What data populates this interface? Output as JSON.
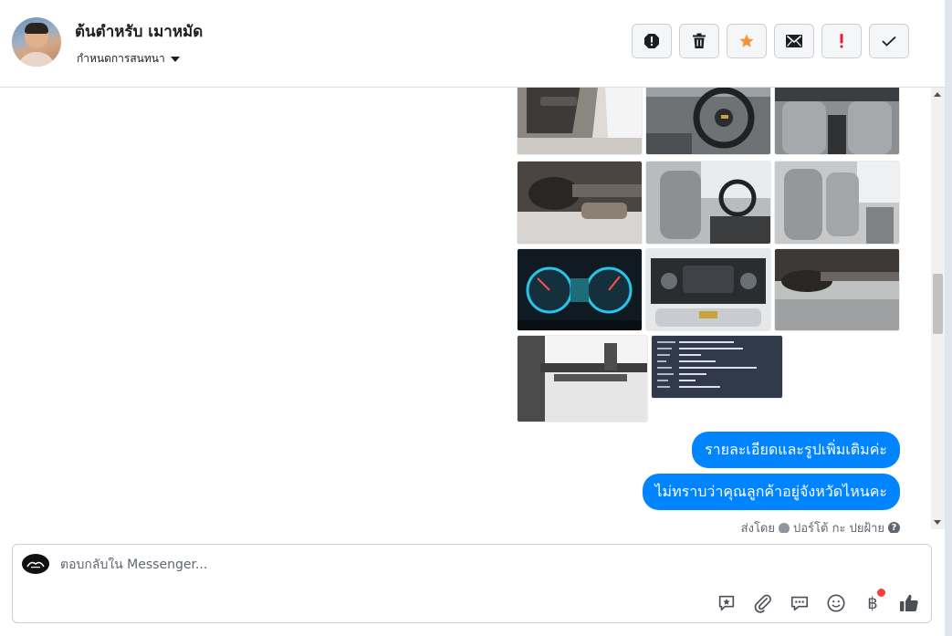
{
  "header": {
    "contact_name": "ต้นตำหรับ เมาหมัด",
    "assign_label": "กำหนดการสนทนา",
    "actions": [
      {
        "name": "spam-button",
        "icon": "alert-circle-icon"
      },
      {
        "name": "delete-button",
        "icon": "trash-icon"
      },
      {
        "name": "star-button",
        "icon": "star-icon",
        "color": "#f7923b"
      },
      {
        "name": "mark-unread-button",
        "icon": "envelope-icon"
      },
      {
        "name": "follow-up-button",
        "icon": "exclamation-icon",
        "color": "#e41e3f"
      },
      {
        "name": "done-button",
        "icon": "check-icon"
      }
    ]
  },
  "conversation": {
    "photos": [
      {
        "name": "photo-door-interior",
        "kind": "car door interior"
      },
      {
        "name": "photo-steering-wheel",
        "kind": "steering wheel dashboard"
      },
      {
        "name": "photo-front-seats-rear-view",
        "kind": "front seats from rear"
      },
      {
        "name": "photo-undercarriage",
        "kind": "undercarriage"
      },
      {
        "name": "photo-driver-seat",
        "kind": "driver seat"
      },
      {
        "name": "photo-passenger-seats",
        "kind": "passenger seats"
      },
      {
        "name": "photo-gauge-cluster",
        "kind": "instrument cluster"
      },
      {
        "name": "photo-engine-bay",
        "kind": "engine bay"
      },
      {
        "name": "photo-chassis",
        "kind": "chassis"
      },
      {
        "name": "photo-suspension",
        "kind": "suspension"
      },
      {
        "name": "photo-spec-screenshot",
        "kind": "spec screenshot"
      }
    ],
    "messages": [
      {
        "text": "รายละเอียดและรูปเพิ่มเติมค่ะ"
      },
      {
        "text": "ไม่ทราบว่าคุณลูกค้าอยู่จังหวัดไหนคะ"
      }
    ],
    "sent_by_prefix": "ส่งโดย",
    "sent_by_name": "ปอร์โต้ กะ ปยฝ้าย",
    "help_glyph": "?"
  },
  "composer": {
    "placeholder": "ตอบกลับใน Messenger...",
    "baht_glyph": "฿",
    "tools": [
      "saved-reply-icon",
      "attachment-icon",
      "chat-bubble-icon",
      "emoji-icon",
      "baht-payment-icon",
      "thumbs-up-icon"
    ]
  },
  "colors": {
    "bubble": "#0084ff",
    "star": "#f7923b",
    "follow_up": "#e41e3f",
    "notify_dot": "#fa3e3e"
  }
}
